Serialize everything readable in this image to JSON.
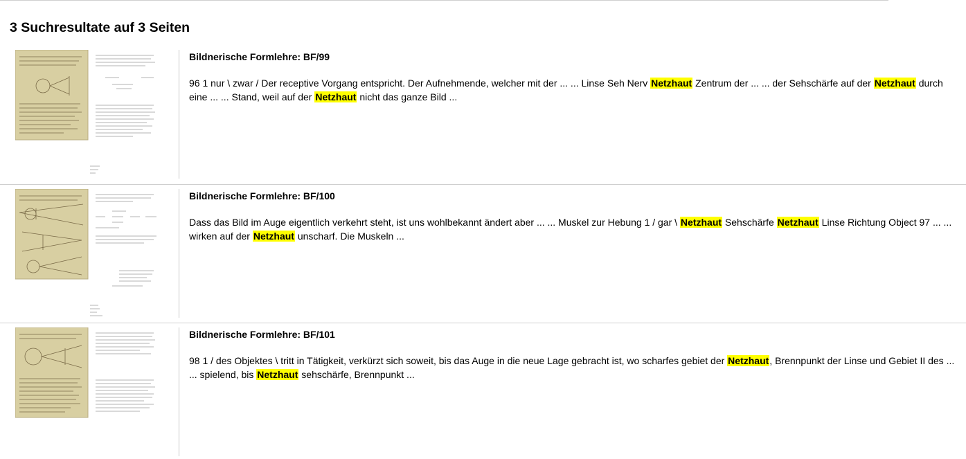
{
  "heading": "3 Suchresultate auf 3 Seiten",
  "highlight_color": "#ffff00",
  "results": [
    {
      "title": "Bildnerische Formlehre: BF/99",
      "snippet": [
        {
          "t": "96 1 nur \\ zwar / Der receptive Vorgang entspricht. Der Aufnehmende, welcher mit der ... ... Linse Seh Nerv "
        },
        {
          "t": "Netzhaut",
          "hl": true
        },
        {
          "t": " Zentrum der ... ... der Sehschärfe auf der "
        },
        {
          "t": "Netzhaut",
          "hl": true
        },
        {
          "t": " durch eine ... ... Stand, weil auf der "
        },
        {
          "t": "Netzhaut",
          "hl": true
        },
        {
          "t": " nicht das ganze Bild ..."
        }
      ]
    },
    {
      "title": "Bildnerische Formlehre: BF/100",
      "snippet": [
        {
          "t": "Dass das Bild im Auge eigentlich verkehrt steht, ist uns wohlbekannt ändert aber ... ... Muskel zur Hebung 1 / gar \\ "
        },
        {
          "t": "Netzhaut",
          "hl": true
        },
        {
          "t": " Sehschärfe "
        },
        {
          "t": "Netzhaut",
          "hl": true
        },
        {
          "t": " Linse Richtung Object 97 ... ... wirken auf der "
        },
        {
          "t": "Netzhaut",
          "hl": true
        },
        {
          "t": " unscharf. Die Muskeln ..."
        }
      ]
    },
    {
      "title": "Bildnerische Formlehre: BF/101",
      "snippet": [
        {
          "t": "98 1 / des Objektes \\ tritt in Tätigkeit, verkürzt sich soweit, bis das Auge in die neue Lage gebracht ist, wo scharfes gebiet der "
        },
        {
          "t": "Netzhaut",
          "hl": true
        },
        {
          "t": ", Brennpunkt der Linse und Gebiet II des ... ... spielend, bis "
        },
        {
          "t": "Netzhaut",
          "hl": true
        },
        {
          "t": " sehschärfe, Brennpunkt ..."
        }
      ]
    }
  ]
}
